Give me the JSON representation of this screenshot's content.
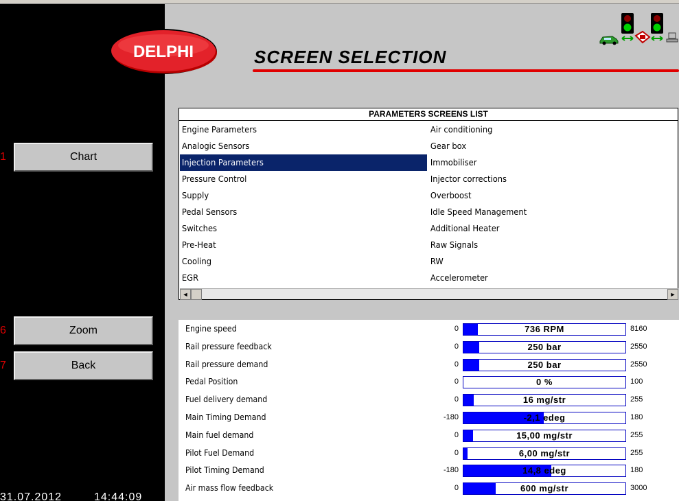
{
  "app": {
    "logo_text": "DELPHI",
    "screen_title": "SCREEN SELECTION",
    "date": "31.07.2012",
    "time": "14:44:09"
  },
  "side_buttons": [
    {
      "key": "1",
      "label": "Chart"
    },
    {
      "key": "6",
      "label": "Zoom"
    },
    {
      "key": "7",
      "label": "Back"
    }
  ],
  "status_icons": [
    "car-icon",
    "traffic-light-icon",
    "link-arrow-icon",
    "ecu-icon",
    "traffic-light-icon",
    "link-arrow-icon",
    "computer-icon"
  ],
  "screens_list": {
    "header": "PARAMETERS SCREENS LIST",
    "left": [
      "Engine Parameters",
      "Analogic Sensors",
      "Injection Parameters",
      "Pressure Control",
      "Supply",
      "Pedal Sensors",
      "Switches",
      "Pre-Heat",
      "Cooling",
      "EGR"
    ],
    "right": [
      "Air conditioning",
      "Gear box",
      "Immobiliser",
      "Injector corrections",
      "Overboost",
      "Idle Speed Management",
      "Additional Heater",
      "Raw Signals",
      "RW",
      "Accelerometer"
    ],
    "selected": "Injection Parameters"
  },
  "parameters": [
    {
      "label": "Engine speed",
      "min": "0",
      "max": "8160",
      "value": "736 RPM",
      "fill": 0.09
    },
    {
      "label": "Rail pressure feedback",
      "min": "0",
      "max": "2550",
      "value": "250 bar",
      "fill": 0.098
    },
    {
      "label": "Rail pressure demand",
      "min": "0",
      "max": "2550",
      "value": "250 bar",
      "fill": 0.098
    },
    {
      "label": "Pedal Position",
      "min": "0",
      "max": "100",
      "value": "0 %",
      "fill": 0
    },
    {
      "label": "Fuel delivery demand",
      "min": "0",
      "max": "255",
      "value": "16 mg/str",
      "fill": 0.063
    },
    {
      "label": "Main Timing Demand",
      "min": "-180",
      "max": "180",
      "value": "-2,1 edeg",
      "fill": 0.494
    },
    {
      "label": "Main fuel demand",
      "min": "0",
      "max": "255",
      "value": "15,00 mg/str",
      "fill": 0.059
    },
    {
      "label": "Pilot Fuel Demand",
      "min": "0",
      "max": "255",
      "value": "6,00 mg/str",
      "fill": 0.024
    },
    {
      "label": "Pilot Timing Demand",
      "min": "-180",
      "max": "180",
      "value": "14,8 edeg",
      "fill": 0.541
    },
    {
      "label": "Air mass flow feedback",
      "min": "0",
      "max": "3000",
      "value": "600 mg/str",
      "fill": 0.2
    }
  ],
  "colors": {
    "accent_red": "#e00000",
    "selection": "#0a246a",
    "bar_fill": "#0000ff"
  }
}
